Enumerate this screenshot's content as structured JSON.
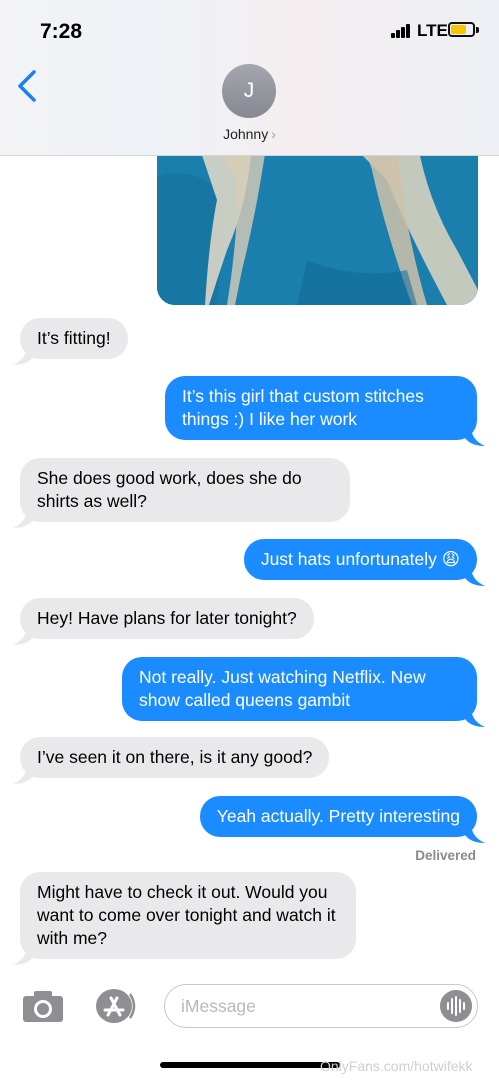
{
  "status_bar": {
    "time": "7:28",
    "network": "LTE",
    "battery_level": 0.6,
    "battery_color": "#f7c400"
  },
  "header": {
    "back_icon": "chevron-left-icon",
    "avatar_initial": "J",
    "contact_name": "Johnny",
    "contact_chevron": "›"
  },
  "conversation": {
    "photo": {
      "icon": "photo-attachment",
      "dominant_color": "#1f86b6"
    },
    "messages": [
      {
        "side": "in",
        "text": "It’s fitting!"
      },
      {
        "side": "out",
        "text": "It’s this girl that custom stitches things :) I like her work"
      },
      {
        "side": "in",
        "text": "She does good work, does she do shirts as well?"
      },
      {
        "side": "out",
        "text": "Just hats unfortunately 😩"
      },
      {
        "side": "in",
        "text": "Hey! Have plans for later tonight?"
      },
      {
        "side": "out",
        "text": "Not really. Just watching Netflix. New show called queens gambit"
      },
      {
        "side": "in",
        "text": "I’ve seen it on there, is it any good?"
      },
      {
        "side": "out",
        "text": "Yeah actually. Pretty interesting"
      },
      {
        "side": "in",
        "text": "Might have to check it out. Would you want to come over tonight and watch it with me?"
      }
    ],
    "delivered_label": "Delivered"
  },
  "input_bar": {
    "camera_icon": "camera-icon",
    "apps_icon": "app-store-icon",
    "placeholder": "iMessage",
    "audio_icon": "audio-waveform-icon"
  },
  "watermark": "OnlyFans.com/hotwifekk",
  "colors": {
    "outgoing": "#1a8cff",
    "incoming": "#e9e9eb",
    "accent": "#1a7ff5"
  }
}
